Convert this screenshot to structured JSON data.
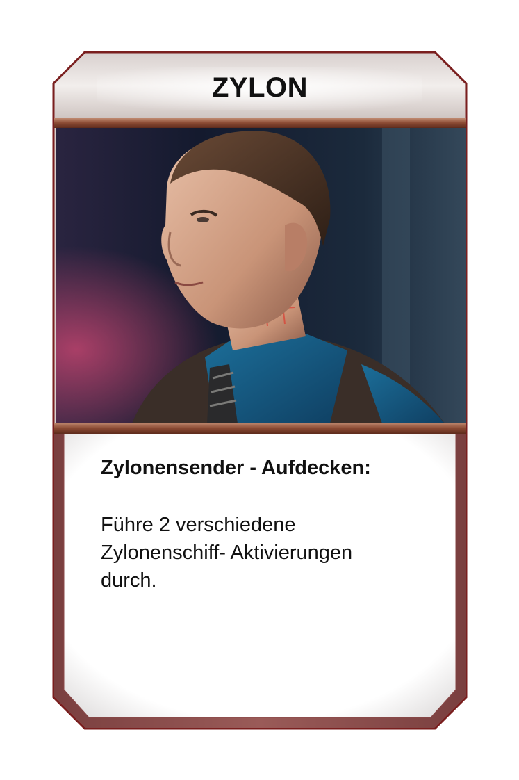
{
  "card": {
    "title": "ZYLON",
    "ability_title": "Zylonensender - Aufdecken:",
    "ability_text": "Führe 2 verschiedene\nZylonenschiff- Aktivierungen\ndurch."
  },
  "colors": {
    "frame_border": "#7a1e1e",
    "banner": "#e9e4e2",
    "bar": "#8a4a33",
    "text_panel": "#ffffff",
    "text": "#111111"
  },
  "portrait": {
    "icon": "man-portrait-icon"
  }
}
